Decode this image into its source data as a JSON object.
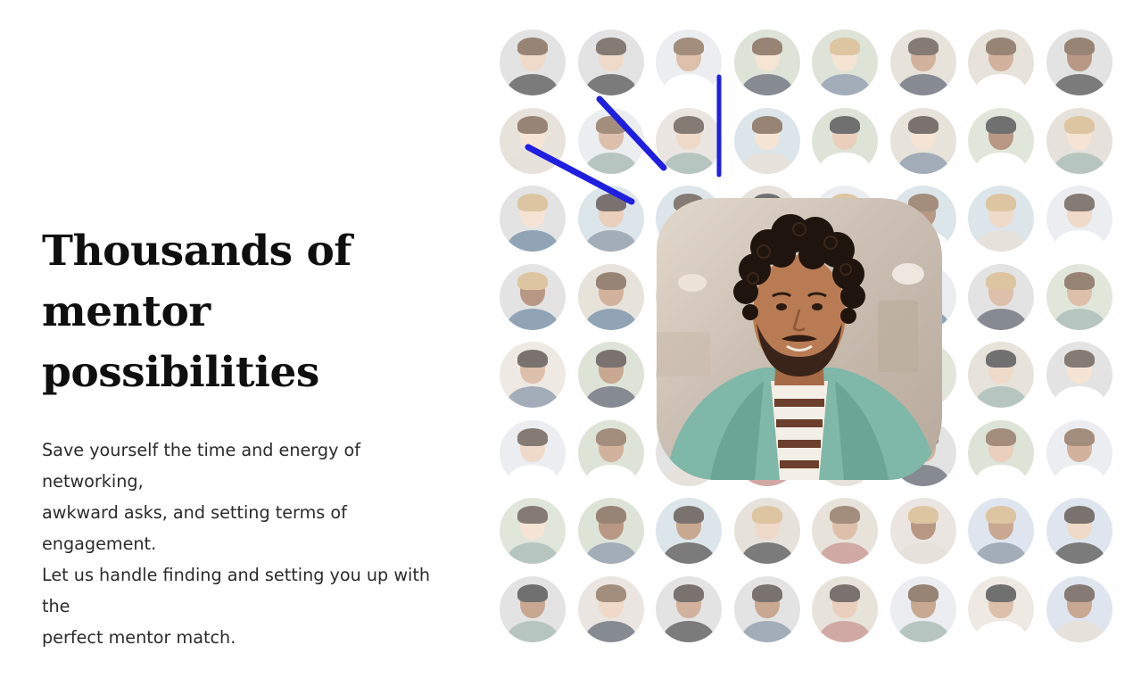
{
  "headline": {
    "line1": "Thousands of mentor",
    "line2": "possibilities"
  },
  "description": [
    "Save yourself the time and energy of networking,",
    "awkward asks, and setting terms of engagement.",
    "Let us handle finding and setting you up with the",
    "perfect mentor match."
  ],
  "mosaic": {
    "rows": 8,
    "cols": 8,
    "featured_icon": "mentor-portrait",
    "scribble_color": "#1f1fe0"
  }
}
